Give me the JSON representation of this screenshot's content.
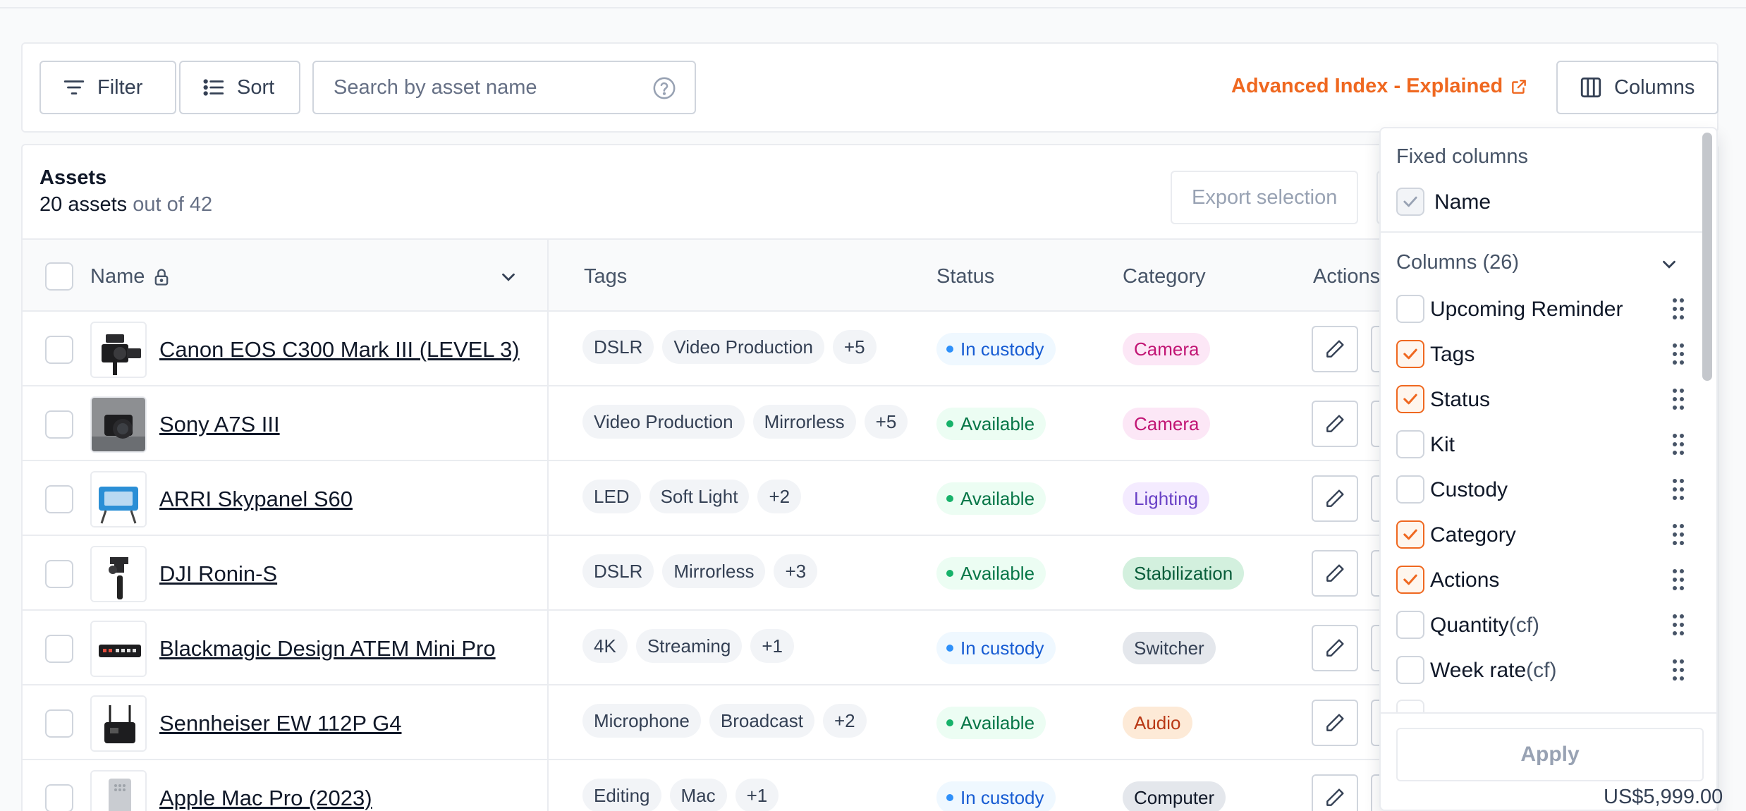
{
  "toolbar": {
    "filter_label": "Filter",
    "sort_label": "Sort",
    "search_placeholder": "Search by asset name",
    "advanced_link": "Advanced Index - Explained",
    "columns_label": "Columns"
  },
  "assets_card": {
    "title": "Assets",
    "count": "20 assets",
    "out_of": "out of 42",
    "export_label": "Export selection"
  },
  "table": {
    "headers": {
      "name": "Name",
      "tags": "Tags",
      "status": "Status",
      "category": "Category",
      "actions": "Actions"
    },
    "rows": [
      {
        "name": "Canon EOS C300 Mark III (LEVEL 3)",
        "tags": [
          "DSLR",
          "Video Production"
        ],
        "more": "+5",
        "status": "In custody",
        "category": "Camera",
        "faded": "0C"
      },
      {
        "name": "Sony A7S III",
        "tags": [
          "Video Production",
          "Mirrorless"
        ],
        "more": "+5",
        "status": "Available",
        "category": "Camera",
        "faded": "0"
      },
      {
        "name": "ARRI Skypanel S60",
        "tags": [
          "LED",
          "Soft Light"
        ],
        "more": "+2",
        "status": "Available",
        "category": "Lighting",
        "faded": "0"
      },
      {
        "name": "DJI Ronin-S",
        "tags": [
          "DSLR",
          "Mirrorless"
        ],
        "more": "+3",
        "status": "Available",
        "category": "Stabilization",
        "faded": ""
      },
      {
        "name": "Blackmagic Design ATEM Mini Pro",
        "tags": [
          "4K",
          "Streaming"
        ],
        "more": "+1",
        "status": "In custody",
        "category": "Switcher",
        "faded": ""
      },
      {
        "name": "Sennheiser EW 112P G4",
        "tags": [
          "Microphone",
          "Broadcast"
        ],
        "more": "+2",
        "status": "Available",
        "category": "Audio",
        "faded": ""
      },
      {
        "name": "Apple Mac Pro (2023)",
        "tags": [
          "Editing",
          "Mac"
        ],
        "more": "+1",
        "status": "In custody",
        "category": "Computer",
        "faded": ""
      }
    ],
    "last_row_price": "US$5,999.00"
  },
  "columns_panel": {
    "fixed_title": "Fixed columns",
    "fixed_name": "Name",
    "columns_title": "Columns (26)",
    "items": [
      {
        "label": "Upcoming Reminder",
        "cf": "",
        "checked": false
      },
      {
        "label": "Tags",
        "cf": "",
        "checked": true
      },
      {
        "label": "Status",
        "cf": "",
        "checked": true
      },
      {
        "label": "Kit",
        "cf": "",
        "checked": false
      },
      {
        "label": "Custody",
        "cf": "",
        "checked": false
      },
      {
        "label": "Category",
        "cf": "",
        "checked": true
      },
      {
        "label": "Actions",
        "cf": "",
        "checked": true
      },
      {
        "label": "Quantity",
        "cf": "(cf)",
        "checked": false
      },
      {
        "label": "Week rate",
        "cf": "(cf)",
        "checked": false
      }
    ],
    "apply_label": "Apply"
  },
  "colors": {
    "accent": "#ef6820",
    "in_custody_bg": "#eff8ff",
    "in_custody_fg": "#175cd3",
    "available_bg": "#ecfdf3",
    "available_fg": "#067647",
    "camera_bg": "#fce7f6",
    "camera_fg": "#c11574",
    "lighting_bg": "#f4ebff",
    "lighting_fg": "#6941c6",
    "stabilization_bg": "#d3f0de",
    "stabilization_fg": "#085d3a",
    "switcher_bg": "#e4e7ec",
    "switcher_fg": "#344054",
    "audio_bg": "#fdead7",
    "audio_fg": "#b93815",
    "computer_bg": "#e4e7ec",
    "computer_fg": "#101828"
  }
}
